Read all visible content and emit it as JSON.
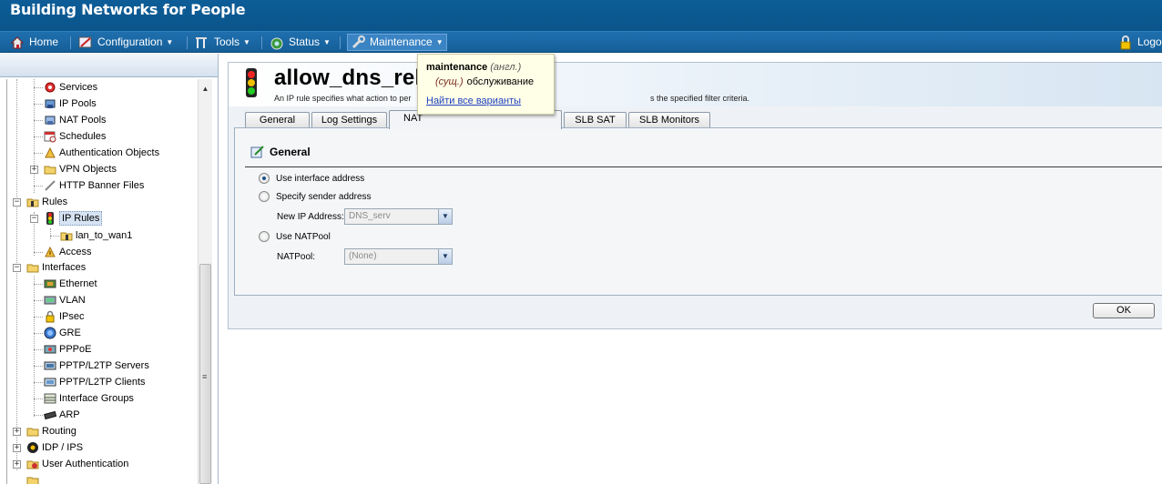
{
  "banner": {
    "brand": "Building Networks for People"
  },
  "menubar": {
    "items": [
      {
        "label": "Home",
        "icon": "home-icon",
        "has_caret": false
      },
      {
        "label": "Configuration",
        "icon": "configuration-icon",
        "has_caret": true
      },
      {
        "label": "Tools",
        "icon": "tools-icon",
        "has_caret": true
      },
      {
        "label": "Status",
        "icon": "status-icon",
        "has_caret": true
      },
      {
        "label": "Maintenance",
        "icon": "wrench-icon",
        "has_caret": true
      }
    ],
    "logout_label": "Logo",
    "caret": "▼"
  },
  "tree": {
    "items": [
      {
        "label": "Services",
        "icon": "services-icon"
      },
      {
        "label": "IP Pools",
        "icon": "ip-pools-icon"
      },
      {
        "label": "NAT Pools",
        "icon": "nat-pools-icon"
      },
      {
        "label": "Schedules",
        "icon": "schedules-icon"
      },
      {
        "label": "Authentication Objects",
        "icon": "auth-objects-icon"
      },
      {
        "label": "VPN Objects",
        "icon": "vpn-objects-icon"
      },
      {
        "label": "HTTP Banner Files",
        "icon": "http-banner-icon"
      },
      {
        "label": "Rules",
        "icon": "rules-folder-icon"
      },
      {
        "label": "IP Rules",
        "icon": "traffic-light-icon"
      },
      {
        "label": "lan_to_wan1",
        "icon": "rule-set-icon"
      },
      {
        "label": "Access",
        "icon": "access-icon"
      },
      {
        "label": "Interfaces",
        "icon": "interfaces-folder-icon"
      },
      {
        "label": "Ethernet",
        "icon": "ethernet-icon"
      },
      {
        "label": "VLAN",
        "icon": "vlan-icon"
      },
      {
        "label": "IPsec",
        "icon": "lock-icon"
      },
      {
        "label": "GRE",
        "icon": "gre-icon"
      },
      {
        "label": "PPPoE",
        "icon": "pppoe-icon"
      },
      {
        "label": "PPTP/L2TP Servers",
        "icon": "pptp-servers-icon"
      },
      {
        "label": "PPTP/L2TP Clients",
        "icon": "pptp-clients-icon"
      },
      {
        "label": "Interface Groups",
        "icon": "interface-groups-icon"
      },
      {
        "label": "ARP",
        "icon": "arp-icon"
      },
      {
        "label": "Routing",
        "icon": "routing-folder-icon"
      },
      {
        "label": "IDP / IPS",
        "icon": "idp-icon"
      },
      {
        "label": "User Authentication",
        "icon": "user-auth-icon"
      }
    ],
    "expander_plus": "+",
    "expander_minus": "−",
    "scroll_up": "▲",
    "scroll_grip": "≡"
  },
  "page": {
    "title": "allow_dns_rela",
    "description": "An IP rule specifies what action to per",
    "description_tail": "s the specified filter criteria."
  },
  "tabs": [
    {
      "label": "General"
    },
    {
      "label": "Log Settings"
    },
    {
      "label": "NAT"
    },
    {
      "label": "SLB SAT"
    },
    {
      "label": "SLB Monitors"
    }
  ],
  "section": {
    "title": "General",
    "radio_interface": "Use interface address",
    "radio_sender": "Specify sender address",
    "new_ip_label": "New IP Address:",
    "new_ip_value": "DNS_serv",
    "radio_natpool": "Use NATPool",
    "natpool_label": "NATPool:",
    "natpool_value": "(None)",
    "arrow": "▼"
  },
  "ok_label": "OK",
  "tooltip": {
    "word": "maintenance",
    "lang": "(англ.)",
    "pos": "(сущ.)",
    "translation": "обслуживание",
    "link": "Найти все варианты"
  },
  "colors": {
    "banner": "#0b5890",
    "menubar": "#1a66a3",
    "tooltip_bg": "#ffffe7",
    "selected": "#d6e3f3"
  }
}
